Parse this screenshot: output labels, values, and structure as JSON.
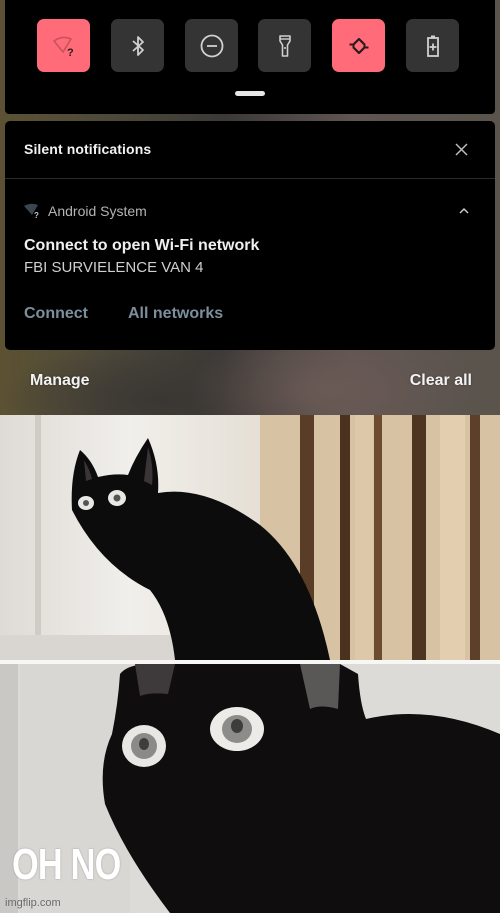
{
  "quick_settings": {
    "tiles": [
      {
        "name": "wifi-no-internet",
        "icon": "wifi-question-icon",
        "state": "on"
      },
      {
        "name": "bluetooth",
        "icon": "bluetooth-icon",
        "state": "off"
      },
      {
        "name": "do-not-disturb",
        "icon": "minus-circle-icon",
        "state": "off"
      },
      {
        "name": "flashlight",
        "icon": "flashlight-icon",
        "state": "off"
      },
      {
        "name": "auto-rotate",
        "icon": "rotate-icon",
        "state": "on"
      },
      {
        "name": "battery-saver",
        "icon": "battery-plus-icon",
        "state": "off"
      }
    ],
    "colors": {
      "on": "#ff6b78",
      "off": "#343434",
      "icon_off": "#d0d0d0",
      "icon_on": "#2a1a1c"
    }
  },
  "notifications": {
    "section_title": "Silent notifications",
    "items": [
      {
        "app_name": "Android System",
        "app_icon": "wifi-question-icon",
        "title": "Connect to open Wi-Fi network",
        "text": "FBI SURVIELENCE VAN 4",
        "actions": [
          "Connect",
          "All networks"
        ]
      }
    ],
    "accent_color": "#7c8f9c"
  },
  "footer": {
    "manage_label": "Manage",
    "clear_all_label": "Clear all"
  },
  "meme": {
    "caption": "OH NO",
    "watermark": "imgflip.com"
  }
}
